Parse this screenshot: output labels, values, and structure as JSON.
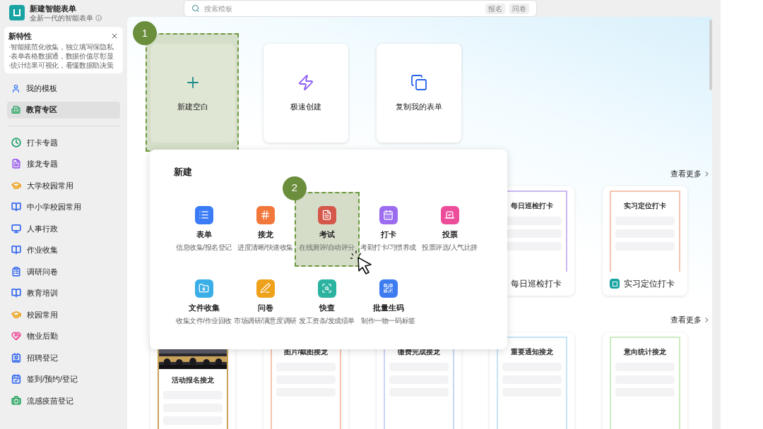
{
  "app": {
    "title": "新建智能表单",
    "subtitle": "全新一代的智能表单"
  },
  "features": {
    "title": "新特性",
    "lines": [
      "·智能规范化收集，独立填写保隐私",
      "·表单表格数据通，数据价值尽彰显",
      "·统计结果可视化，看懂数据助决策"
    ]
  },
  "nav_top": [
    {
      "label": "我的模板",
      "selected": false,
      "color": "#3b7cf6"
    },
    {
      "label": "教育专区",
      "selected": true,
      "color": "#2aa765"
    }
  ],
  "nav": [
    {
      "label": "打卡专题",
      "color": "#1f9e6a"
    },
    {
      "label": "接龙专题",
      "color": "#9b5cf0"
    },
    {
      "label": "大学校园常用",
      "color": "#f0a21a"
    },
    {
      "label": "中小学校园常用",
      "color": "#3b6cf0"
    },
    {
      "label": "人事行政",
      "color": "#3b6cf0"
    },
    {
      "label": "作业收集",
      "color": "#3b6cf0"
    },
    {
      "label": "调研问卷",
      "color": "#3b6cf0"
    },
    {
      "label": "教育培训",
      "color": "#3b6cf0"
    },
    {
      "label": "校园常用",
      "color": "#f0a21a"
    },
    {
      "label": "物业后勤",
      "color": "#ec4d9a"
    },
    {
      "label": "招聘登记",
      "color": "#3b6cf0"
    },
    {
      "label": "签到/预约/登记",
      "color": "#3b6cf0"
    },
    {
      "label": "流感疫苗登记",
      "color": "#2aa765"
    }
  ],
  "search": {
    "placeholder": "搜索模板",
    "chips": [
      "报名",
      "问卷"
    ]
  },
  "quick_cards": [
    {
      "label": "新建空白",
      "highlighted": true,
      "callout": "1"
    },
    {
      "label": "极速创建",
      "highlighted": false
    },
    {
      "label": "复制我的表单",
      "highlighted": false
    }
  ],
  "popup": {
    "title": "新建",
    "items": [
      {
        "name": "表单",
        "desc": "信息收集/报名登记",
        "color": "#3b7cf6",
        "highlighted": false
      },
      {
        "name": "接龙",
        "desc": "进度清晰/快速收集",
        "color": "#f2773a",
        "highlighted": false
      },
      {
        "name": "考试",
        "desc": "在线测评/自动评分",
        "color": "#d4574a",
        "highlighted": true,
        "callout": "2"
      },
      {
        "name": "打卡",
        "desc": "考勤打卡/习惯养成",
        "color": "#9b6cf0",
        "highlighted": false
      },
      {
        "name": "投票",
        "desc": "投票评选/人气比拼",
        "color": "#ec4d9a",
        "highlighted": false
      },
      {
        "name": "文件收集",
        "desc": "收集文件/作业回收",
        "color": "#3aaee6",
        "highlighted": false
      },
      {
        "name": "问卷",
        "desc": "市场调研/满意度调研",
        "color": "#eea11a",
        "highlighted": false
      },
      {
        "name": "快查",
        "desc": "发工资条/发成绩单",
        "color": "#2bb3a0",
        "highlighted": false
      },
      {
        "name": "批量生码",
        "desc": "制作一物一码标签",
        "color": "#3d7cf0",
        "highlighted": false
      }
    ]
  },
  "sections": [
    {
      "more": "查看更多",
      "cards": [
        {
          "preview_title": "每日巡检打卡",
          "caption": "每日巡检打卡",
          "color": "#c9b8f0",
          "logo": false
        },
        {
          "preview_title": "实习定位打卡",
          "caption": "实习定位打卡",
          "color": "#f5c4b0",
          "logo": true
        }
      ]
    },
    {
      "more": "查看更多",
      "cards": [
        {
          "preview_title": "活动报名接龙",
          "color": "#c9a25a"
        },
        {
          "preview_title": "图片/截图接龙",
          "color": "#f5c4b0"
        },
        {
          "preview_title": "缴费完成接龙",
          "color": "#c8d6f5"
        },
        {
          "preview_title": "重要通知接龙",
          "color": "#c4e4f5"
        },
        {
          "preview_title": "意向统计接龙",
          "color": "#cdebc4"
        }
      ]
    }
  ]
}
